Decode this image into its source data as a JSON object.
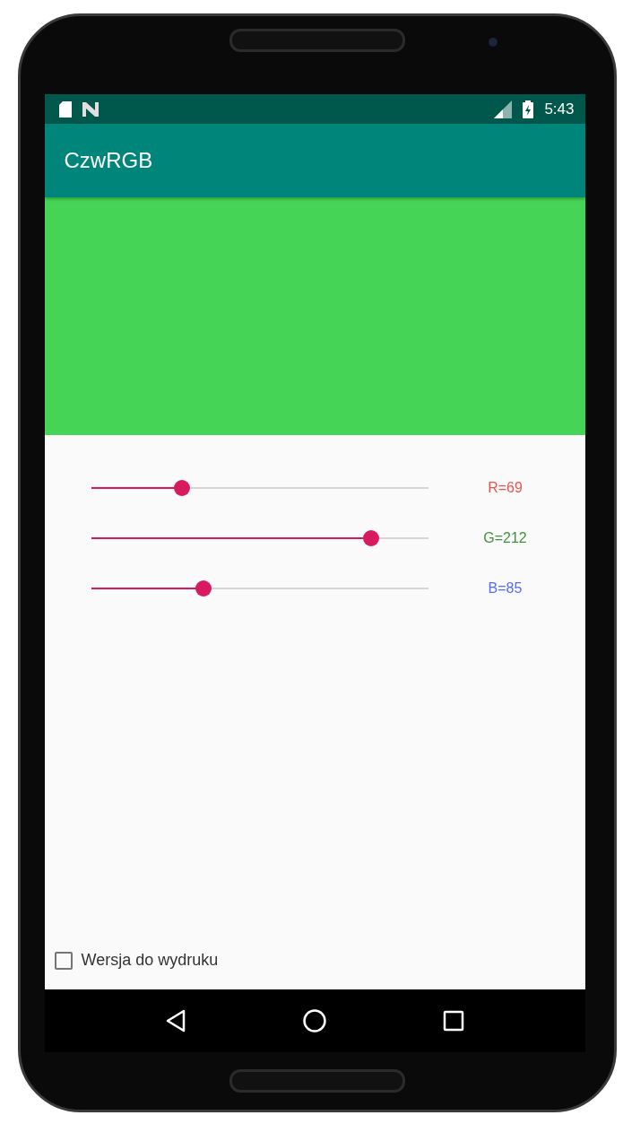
{
  "status_bar": {
    "time": "5:43"
  },
  "app_bar": {
    "title": "CzwRGB"
  },
  "sliders": [
    {
      "label": "R=69",
      "level": 0.2706,
      "color": "#ef5350"
    },
    {
      "label": "G=212",
      "level": 0.8314,
      "color": "#43913f"
    },
    {
      "label": "B=85",
      "level": 0.3333,
      "color": "#536dfe"
    }
  ],
  "checkbox": {
    "label": "Wersja do wydruku",
    "checked": false
  }
}
